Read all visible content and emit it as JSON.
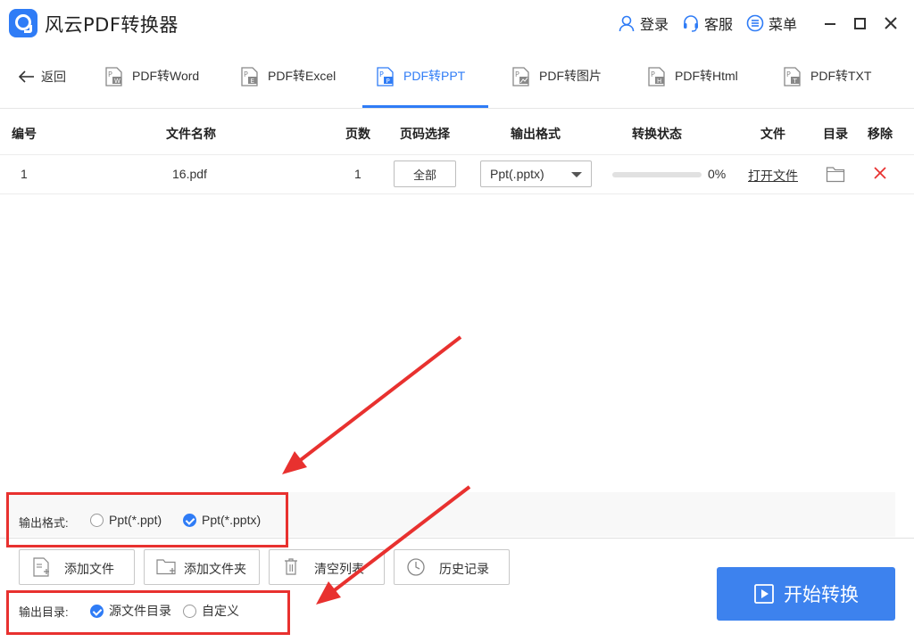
{
  "app": {
    "title": "风云PDF转换器",
    "login_label": "登录",
    "service_label": "客服",
    "menu_label": "菜单"
  },
  "nav": {
    "back_label": "返回",
    "tabs": [
      {
        "label": "PDF转Word",
        "icon": "pdf-word-icon",
        "active": false
      },
      {
        "label": "PDF转Excel",
        "icon": "pdf-excel-icon",
        "active": false
      },
      {
        "label": "PDF转PPT",
        "icon": "pdf-ppt-icon",
        "active": true
      },
      {
        "label": "PDF转图片",
        "icon": "pdf-image-icon",
        "active": false
      },
      {
        "label": "PDF转Html",
        "icon": "pdf-html-icon",
        "active": false
      },
      {
        "label": "PDF转TXT",
        "icon": "pdf-txt-icon",
        "active": false
      }
    ]
  },
  "table": {
    "headers": [
      "编号",
      "文件名称",
      "页数",
      "页码选择",
      "输出格式",
      "转换状态",
      "文件",
      "目录",
      "移除"
    ],
    "rows": [
      {
        "index": "1",
        "filename": "16.pdf",
        "pages": "1",
        "page_select": "全部",
        "format": "Ppt(.pptx)",
        "progress_text": "0%",
        "progress_value": 0,
        "open_file": "打开文件"
      }
    ]
  },
  "output_format": {
    "label": "输出格式:",
    "options": [
      {
        "label": "Ppt(*.ppt)",
        "checked": false
      },
      {
        "label": "Ppt(*.pptx)",
        "checked": true
      }
    ]
  },
  "actions": {
    "add_file": "添加文件",
    "add_folder": "添加文件夹",
    "clear_list": "清空列表",
    "history": "历史记录"
  },
  "output_dir": {
    "label": "输出目录:",
    "options": [
      {
        "label": "源文件目录",
        "checked": true
      },
      {
        "label": "自定义",
        "checked": false
      }
    ]
  },
  "start_label": "开始转换",
  "colors": {
    "accent": "#2f7cf6",
    "start_button": "#3d82ee",
    "annotation": "#e8312f",
    "remove": "#e8312f"
  }
}
